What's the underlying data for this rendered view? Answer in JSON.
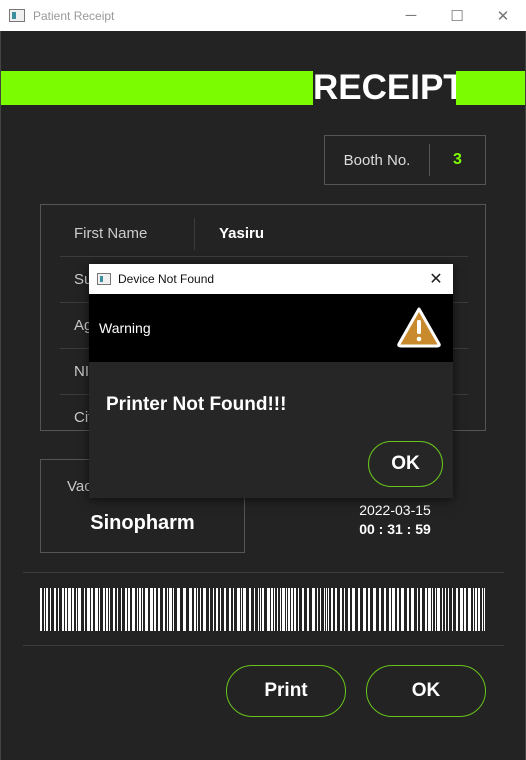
{
  "window": {
    "title": "Patient Receipt",
    "controls": {
      "minimize": "─",
      "maximize": "☐",
      "close": "✕"
    }
  },
  "receipt": {
    "title": "RECEIPT",
    "booth_label": "Booth No.",
    "booth_value": "3",
    "fields": [
      {
        "label": "First Name",
        "value": "Yasiru"
      },
      {
        "label": "Su",
        "value": ""
      },
      {
        "label": "Ag",
        "value": ""
      },
      {
        "label": "NI",
        "value": ""
      },
      {
        "label": "Cit",
        "value": ""
      }
    ],
    "vaccine_label": "Vac",
    "vaccine_value": "Sinopharm",
    "date": "2022-03-15",
    "time": "00 : 31 : 59",
    "print_label": "Print",
    "ok_label": "OK"
  },
  "dialog": {
    "title": "Device Not Found",
    "close": "✕",
    "header": "Warning",
    "icon": "warning-icon",
    "message": "Printer Not Found!!!",
    "ok_label": "OK"
  },
  "colors": {
    "accent": "#7cfc00",
    "button_border": "#6ac41c",
    "background": "#232323",
    "warning_icon": "#c98a2e"
  }
}
